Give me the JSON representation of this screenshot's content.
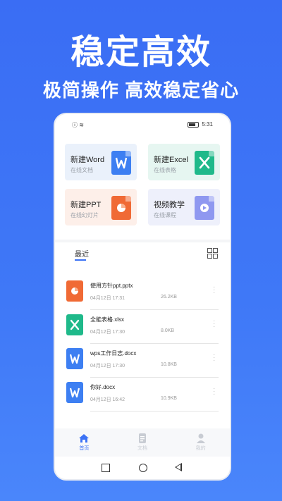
{
  "headline": "稳定高效",
  "subline": "极简操作 高效稳定省心",
  "statusbar": {
    "time": "5:31",
    "signal": "ⓘ ≋"
  },
  "cards": [
    {
      "title": "新建Word",
      "sub": "在线文档",
      "bg": "#eaf1fb",
      "icon": "word-icon",
      "icon_color": "#3d7ff2"
    },
    {
      "title": "新建Excel",
      "sub": "在线表格",
      "bg": "#e6f6f1",
      "icon": "excel-icon",
      "icon_color": "#1fb98a"
    },
    {
      "title": "新建PPT",
      "sub": "在线幻灯片",
      "bg": "#fdefe9",
      "icon": "ppt-icon",
      "icon_color": "#f06a35"
    },
    {
      "title": "视频教学",
      "sub": "在线课程",
      "bg": "#eef0fb",
      "icon": "video-icon",
      "icon_color": "#8f98f0"
    }
  ],
  "recent": {
    "tab_label": "最近",
    "files": [
      {
        "name": "使用方针ppt.pptx",
        "date": "04月12日 17:31",
        "size": "26.2KB",
        "icon": "ppt-file-icon",
        "icon_color": "#f06a35"
      },
      {
        "name": "全能表格.xlsx",
        "date": "04月12日 17:30",
        "size": "8.0KB",
        "icon": "excel-file-icon",
        "icon_color": "#1fb98a"
      },
      {
        "name": "wps工作日志.docx",
        "date": "04月12日 17:30",
        "size": "10.8KB",
        "icon": "word-file-icon",
        "icon_color": "#3d7ff2"
      },
      {
        "name": "你好.docx",
        "date": "04月12日 16:42",
        "size": "10.9KB",
        "icon": "word-file-icon",
        "icon_color": "#3d7ff2"
      }
    ]
  },
  "bottomnav": [
    {
      "label": "首页",
      "active": true,
      "icon": "home-icon"
    },
    {
      "label": "文档",
      "active": false,
      "icon": "document-icon"
    },
    {
      "label": "我的",
      "active": false,
      "icon": "profile-icon"
    }
  ],
  "colors": {
    "accent": "#3c73f5",
    "inactive": "#c8ccd3"
  }
}
